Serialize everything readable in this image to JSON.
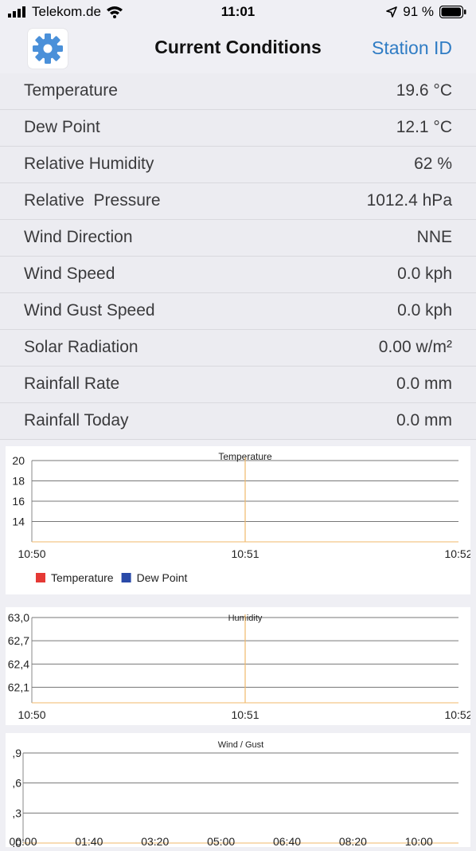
{
  "status_bar": {
    "carrier": "Telekom.de",
    "time": "11:01",
    "battery": "91 %"
  },
  "nav": {
    "title": "Current Conditions",
    "station_id": "Station ID"
  },
  "icons": {
    "settings": "gear-icon",
    "location": "location-arrow-icon",
    "wifi": "wifi-icon",
    "signal": "signal-icon",
    "battery": "battery-icon"
  },
  "colors": {
    "accent": "#2f7cc4",
    "gear": "#4a90d9",
    "temperature_series": "#e53935",
    "dew_point_series": "#2a4aa8",
    "cursor_line": "#f0b96b"
  },
  "conditions": [
    {
      "label": "Temperature",
      "value": "19.6 °C"
    },
    {
      "label": "Dew Point",
      "value": "12.1 °C"
    },
    {
      "label": "Relative Humidity",
      "value": "62 %"
    },
    {
      "label": "Relative  Pressure",
      "value": "1012.4 hPa"
    },
    {
      "label": "Wind Direction",
      "value": "NNE"
    },
    {
      "label": "Wind Speed",
      "value": "0.0 kph"
    },
    {
      "label": "Wind Gust Speed",
      "value": "0.0 kph"
    },
    {
      "label": "Solar Radiation",
      "value": "0.00 w/m²"
    },
    {
      "label": "Rainfall Rate",
      "value": "0.0 mm"
    },
    {
      "label": "Rainfall Today",
      "value": "0.0 mm"
    }
  ],
  "chart_data": [
    {
      "type": "line",
      "title": "Temperature",
      "ylim": [
        12,
        20
      ],
      "yticks": [
        "20",
        "18",
        "16",
        "14"
      ],
      "ytick_values": [
        20,
        18,
        16,
        14
      ],
      "xticks": [
        "10:50",
        "10:51",
        "10:52"
      ],
      "xtick_values": [
        0,
        1,
        2
      ],
      "xlim": [
        0,
        2
      ],
      "cursor_x": 1,
      "legend": [
        "Temperature",
        "Dew Point"
      ],
      "legend_position": "bottom-left",
      "grid": true,
      "series": [
        {
          "name": "Temperature",
          "values": []
        },
        {
          "name": "Dew Point",
          "values": []
        }
      ]
    },
    {
      "type": "line",
      "title": "Humidity",
      "ylim": [
        61.9,
        63.0
      ],
      "yticks": [
        "63,0",
        "62,7",
        "62,4",
        "62,1"
      ],
      "ytick_values": [
        63.0,
        62.7,
        62.4,
        62.1
      ],
      "xticks": [
        "10:50",
        "10:51",
        "10:52"
      ],
      "xtick_values": [
        0,
        1,
        2
      ],
      "xlim": [
        0,
        2
      ],
      "cursor_x": 1,
      "grid": true,
      "series": []
    },
    {
      "type": "line",
      "title": "Wind / Gust",
      "ylim": [
        0,
        0.9
      ],
      "yticks": [
        ",9",
        ",6",
        ",3",
        ",0"
      ],
      "ytick_values": [
        0.9,
        0.6,
        0.3,
        0.0
      ],
      "xticks": [
        "00:00",
        "01:40",
        "03:20",
        "05:00",
        "06:40",
        "08:20",
        "10:00"
      ],
      "xtick_values": [
        0,
        100,
        200,
        300,
        400,
        500,
        600
      ],
      "xlim": [
        0,
        660
      ],
      "grid": true,
      "series": []
    }
  ]
}
